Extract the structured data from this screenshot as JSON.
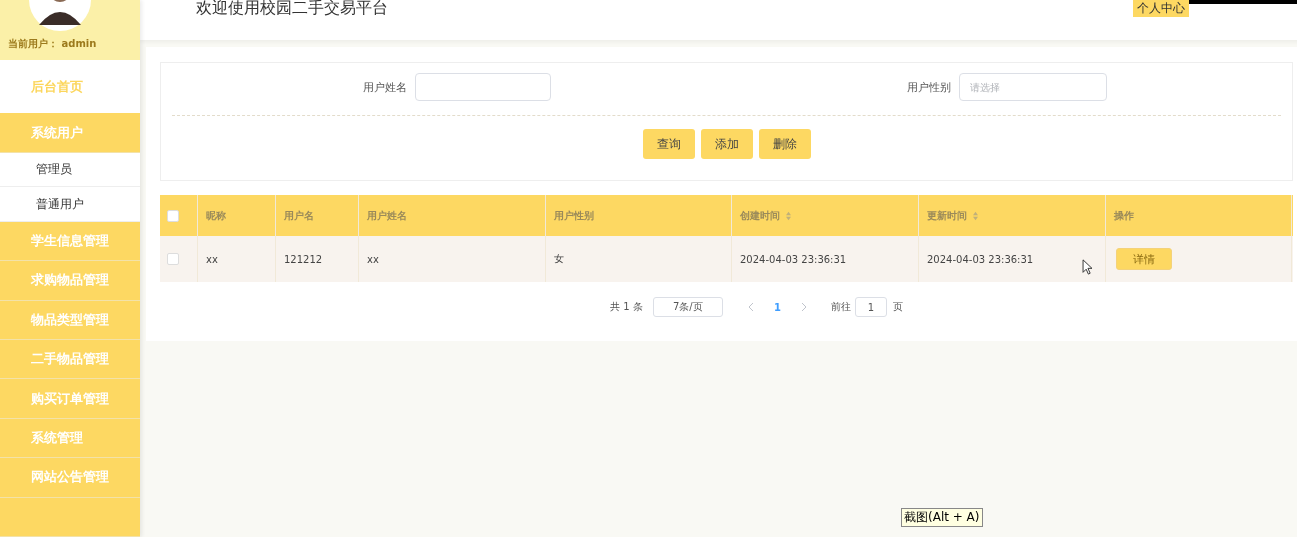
{
  "header": {
    "title": "欢迎使用校园二手交易平台",
    "profile_button": "个人中心"
  },
  "sidebar": {
    "user_label": "当前用户： admin",
    "items": [
      {
        "label": "后台首页",
        "kind": "home"
      },
      {
        "label": "系统用户",
        "kind": "group",
        "expanded": true,
        "children": [
          {
            "label": "管理员"
          },
          {
            "label": "普通用户"
          }
        ]
      },
      {
        "label": "学生信息管理",
        "kind": "group"
      },
      {
        "label": "求购物品管理",
        "kind": "group"
      },
      {
        "label": "物品类型管理",
        "kind": "group"
      },
      {
        "label": "二手物品管理",
        "kind": "group"
      },
      {
        "label": "购买订单管理",
        "kind": "group"
      },
      {
        "label": "系统管理",
        "kind": "group"
      },
      {
        "label": "网站公告管理",
        "kind": "group"
      },
      {
        "kind": "group"
      }
    ]
  },
  "search": {
    "fields": [
      {
        "label": "用户姓名",
        "kind": "input"
      },
      {
        "label": "用户性别",
        "kind": "select",
        "placeholder": "请选择"
      }
    ],
    "buttons": [
      "查询",
      "添加",
      "删除"
    ]
  },
  "table": {
    "header_checked": false,
    "columns": [
      {
        "label": "昵称",
        "sortable": false
      },
      {
        "label": "用户名",
        "sortable": false
      },
      {
        "label": "用户姓名",
        "sortable": false
      },
      {
        "label": "用户性别",
        "sortable": false
      },
      {
        "label": "创建时间",
        "sortable": true
      },
      {
        "label": "更新时间",
        "sortable": true
      },
      {
        "label": "操作",
        "sortable": false
      }
    ],
    "rows": [
      {
        "selected": false,
        "cells": [
          "xx",
          "121212",
          "xx",
          "女",
          "2024-04-03 23:36:31",
          "2024-04-03 23:36:31"
        ],
        "action": "详情"
      }
    ]
  },
  "pagination": {
    "total": "共 1 条",
    "page_size": "7条/页",
    "pages": [
      {
        "label": "1",
        "selected": true
      }
    ],
    "goto_label": "前往",
    "goto_value": "1",
    "goto_suffix": "页"
  },
  "tooltip": "截图(Alt + A)"
}
